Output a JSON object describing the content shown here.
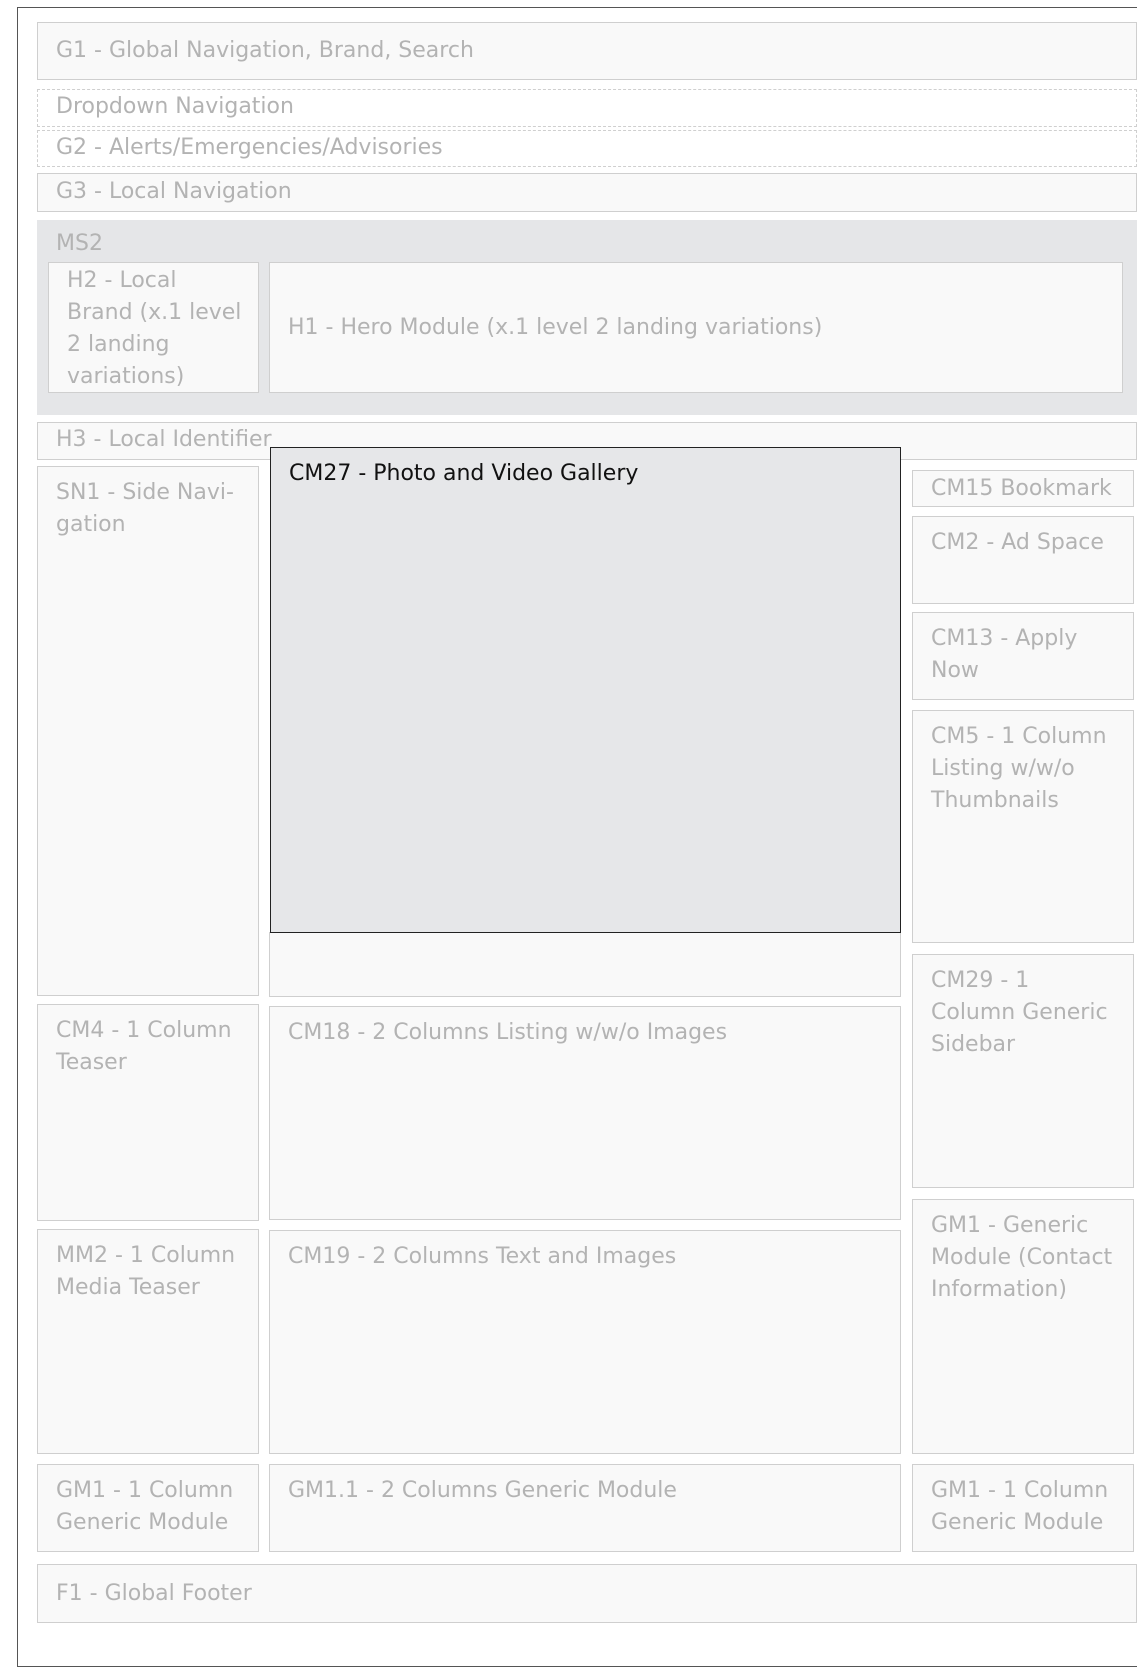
{
  "modules": {
    "g1": "G1 - Global Navigation, Brand, Search",
    "dropdown": "Dropdown Navigation",
    "g2": "G2 - Alerts/Emergencies/Advisories",
    "g3": "G3 - Local Navigation",
    "ms2": "MS2",
    "h2": "H2 - Local Brand (x.1 level 2 landing variations)",
    "h1": "H1 - Hero Module (x.1 level 2 landing variations)",
    "h3": "H3 - Local Identifier",
    "sn1": "SN1 - Side Navi-gation",
    "cm27": "CM27 - Photo and Video Gallery",
    "cm15": "CM15 Bookmark",
    "cm2": "CM2 - Ad Space",
    "cm13": "CM13 - Apply Now",
    "cm5": "CM5 - 1 Column Listing w/w/o Thumbnails",
    "cm29": "CM29 - 1 Column Generic Sidebar",
    "cm4": "CM4 - 1 Column Teaser",
    "cm18": "CM18 - 2 Columns Listing w/w/o Images",
    "gm1_contact": "GM1 - Generic Module (Contact Information)",
    "mm2": "MM2 - 1 Column Media Teaser",
    "cm19": "CM19 - 2 Columns Text and Images",
    "gm1_left": "GM1 - 1 Column Generic Module",
    "gm11": "GM1.1 - 2 Columns Generic Module",
    "gm1_right": "GM1 - 1 Column Generic Module",
    "f1": "F1 - Global Footer"
  }
}
